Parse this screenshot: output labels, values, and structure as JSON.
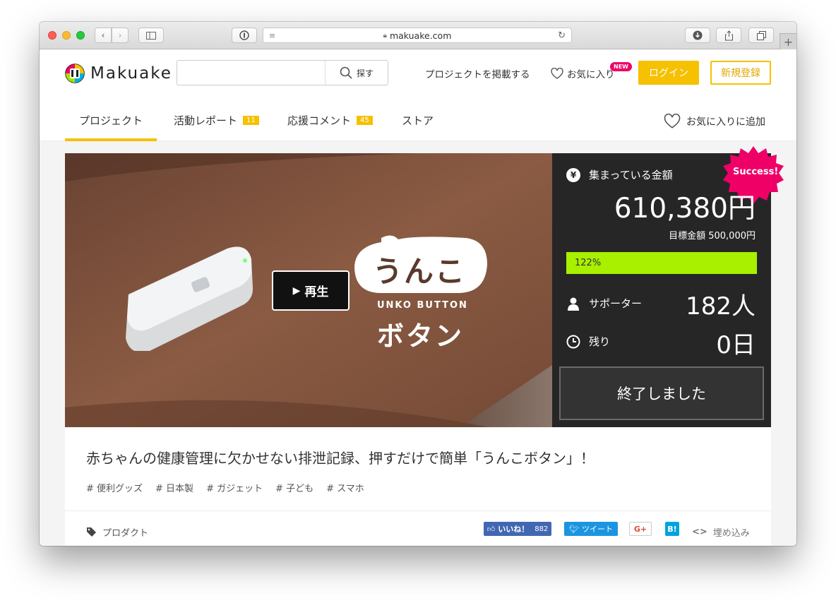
{
  "browser": {
    "url": "makuake.com",
    "colors": {
      "close": "#fc5f57",
      "minimize": "#fdbc2e",
      "maximize": "#28c840"
    }
  },
  "header": {
    "logo_text": "Makuake",
    "search_label": "探す",
    "search_placeholder": "",
    "post_project": "プロジェクトを掲載する",
    "favorites": "お気に入り",
    "new_badge": "NEW",
    "login": "ログイン",
    "register": "新規登録",
    "accent_color": "#f5c100"
  },
  "tabs": [
    {
      "label": "プロジェクト",
      "badge": null,
      "active": true
    },
    {
      "label": "活動レポート",
      "badge": "11"
    },
    {
      "label": "応援コメント",
      "badge": "45"
    },
    {
      "label": "ストア",
      "badge": null
    }
  ],
  "add_favorite": "お気に入りに追加",
  "hero": {
    "play_label": "再生",
    "brand_top": "うんこ",
    "brand_middle": "UNKO BUTTON",
    "brand_bottom": "ボタン"
  },
  "stats": {
    "success_badge": "Success!",
    "collected_label": "集まっている金額",
    "collected_amount": "610,380円",
    "goal_text": "目標金額 500,000円",
    "progress_label": "122%",
    "progress_value": 1.22,
    "progress_color": "#a8f000",
    "supporters_label": "サポーター",
    "supporters_value": "182人",
    "remaining_label": "残り",
    "remaining_value": "0日",
    "ended_label": "終了しました"
  },
  "project": {
    "title": "赤ちゃんの健康管理に欠かせない排泄記録、押すだけで簡単「うんこボタン」！",
    "tags": [
      "# 便利グッズ",
      "# 日本製",
      "# ガジェット",
      "# 子ども",
      "# スマホ"
    ],
    "category": "プロダクト"
  },
  "share": {
    "like_label": "いいね！",
    "like_count": "882",
    "tweet_label": "ツイート",
    "gplus_label": "G+",
    "hatena_label": "B!",
    "embed_label": "埋め込み"
  }
}
